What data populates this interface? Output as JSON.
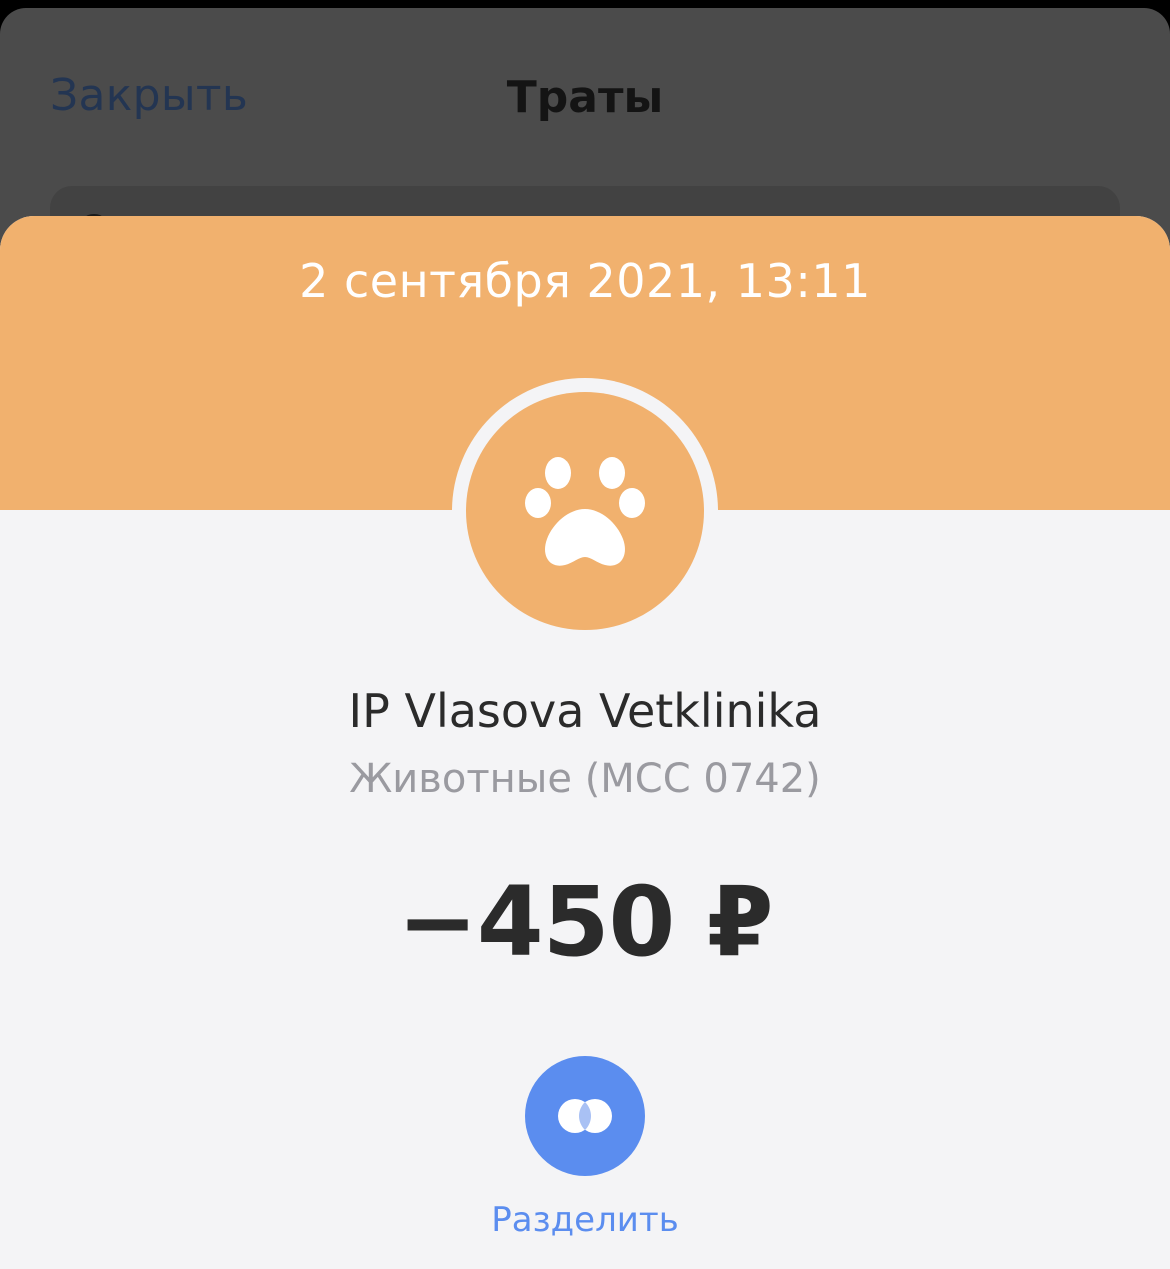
{
  "background_screen": {
    "close_label": "Закрыть",
    "title": "Траты"
  },
  "operation": {
    "date": "2 сентября 2021, 13:11",
    "category_icon": "paw-icon",
    "merchant": "IP Vlasova Vetklinika",
    "category": "Животные (MCC 0742)",
    "amount": "−450 ₽"
  },
  "actions": {
    "split_icon": "split-icon",
    "split_label": "Разделить"
  },
  "colors": {
    "accent_orange": "#f1b16e",
    "action_blue": "#5b8def",
    "card_background": "#f4f4f6"
  }
}
